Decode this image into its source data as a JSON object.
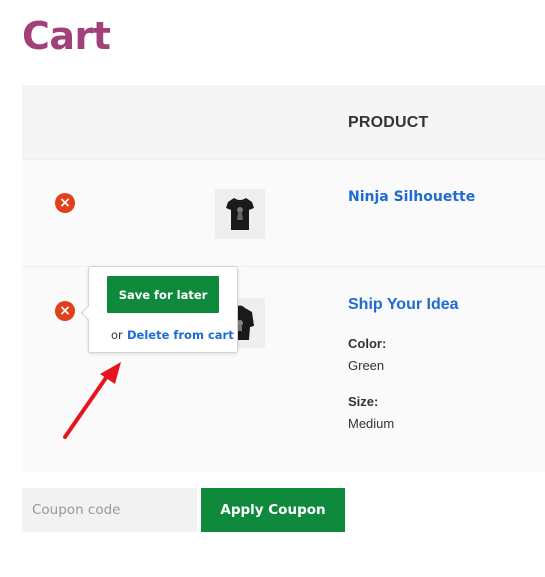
{
  "page": {
    "title": "Cart"
  },
  "table": {
    "header_product": "PRODUCT"
  },
  "items": [
    {
      "remove_symbol": "×",
      "thumb_icon": "tshirt-icon",
      "name": "Ninja Silhouette"
    },
    {
      "remove_symbol": "×",
      "thumb_icon": "hoodie-icon",
      "name": "Ship Your Idea",
      "attributes": [
        {
          "label": "Color:",
          "value": "Green"
        },
        {
          "label": "Size:",
          "value": "Medium"
        }
      ]
    }
  ],
  "popover": {
    "save_label": "Save for later",
    "or_text": "or",
    "delete_label": "Delete from cart"
  },
  "coupon": {
    "placeholder": "Coupon code",
    "apply_label": "Apply Coupon"
  },
  "colors": {
    "title": "#a2407a",
    "link": "#1e6bd1",
    "button": "#0f8a3d",
    "remove": "#e2401c",
    "annotation_arrow": "#e8141c"
  }
}
